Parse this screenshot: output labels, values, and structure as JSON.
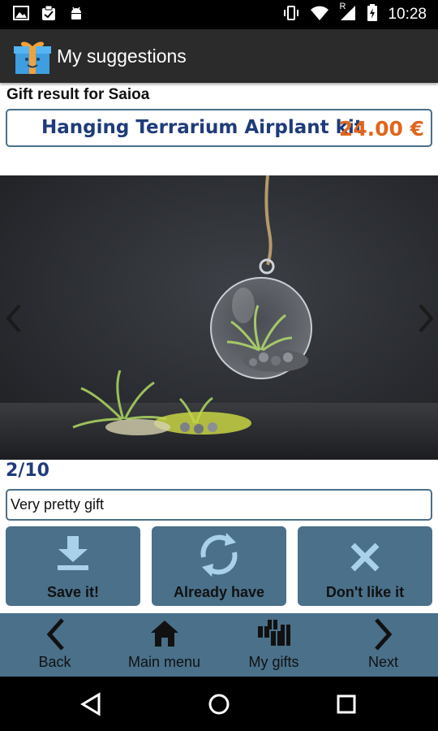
{
  "status_bar": {
    "time": "10:28",
    "icons": [
      "image-icon",
      "clipboard-check-icon",
      "android-icon",
      "vibrate-icon",
      "wifi-icon",
      "signal-roaming-icon",
      "battery-charging-icon"
    ],
    "roaming_indicator": "R"
  },
  "app_bar": {
    "title": "My suggestions",
    "logo": "gift-box-icon"
  },
  "gift": {
    "recipient_line": "Gift result for Saioa",
    "product_name": "Hanging Terrarium Airplant kit",
    "price": "24.00 €"
  },
  "gallery": {
    "image_subject": "hanging glass terrarium with air plant",
    "position": "2/10",
    "prev_icon": "chevron-left-icon",
    "next_icon": "chevron-right-icon"
  },
  "comment": {
    "value": "Very pretty gift"
  },
  "actions": [
    {
      "label": "Save it!",
      "icon": "download-icon"
    },
    {
      "label": "Already have",
      "icon": "refresh-icon"
    },
    {
      "label": "Don't like it",
      "icon": "close-icon"
    }
  ],
  "bottom_nav": [
    {
      "label": "Back",
      "icon": "chevron-left-icon"
    },
    {
      "label": "Main menu",
      "icon": "home-icon"
    },
    {
      "label": "My gifts",
      "icon": "gifts-icon"
    },
    {
      "label": "Next",
      "icon": "chevron-right-icon"
    }
  ],
  "system_nav": [
    "back-triangle-icon",
    "home-circle-icon",
    "recents-square-icon"
  ],
  "colors": {
    "accent_blue": "#4a708a",
    "title_navy": "#1f3b7a",
    "price_orange": "#e0661c",
    "icon_light": "#a9d2ea"
  }
}
